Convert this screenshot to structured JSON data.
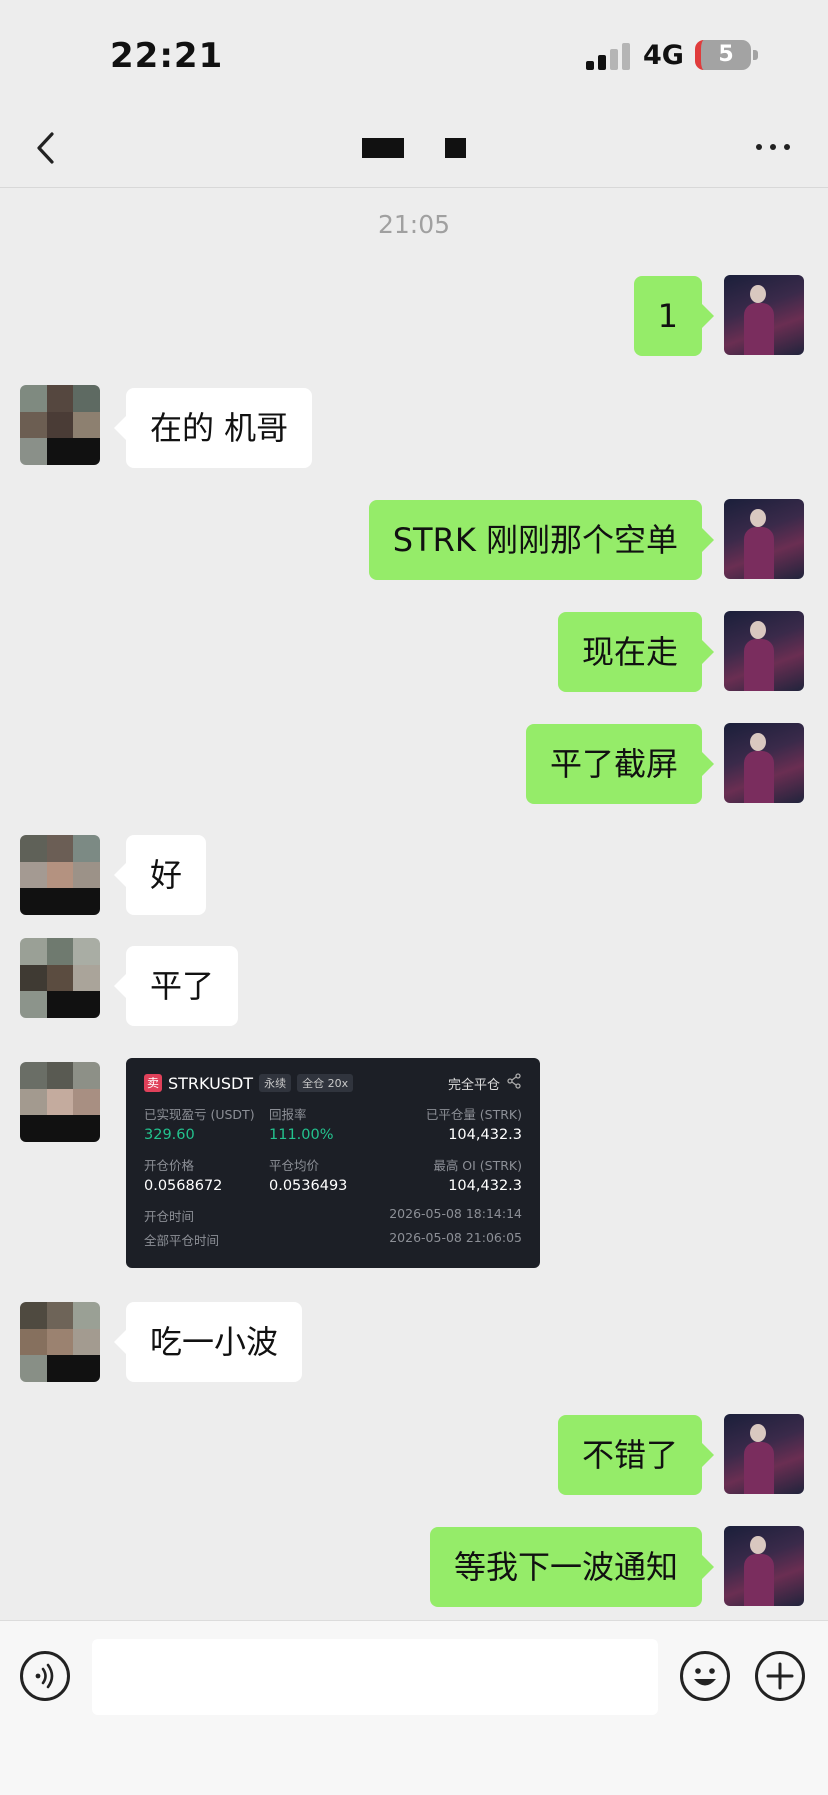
{
  "status_bar": {
    "time": "22:21",
    "network": "4G",
    "battery": "5"
  },
  "nav": {
    "back_icon": "chevron-left-icon",
    "more_icon": "more-dots-icon"
  },
  "timestamp": "21:05",
  "messages": [
    {
      "side": "out",
      "text": "1"
    },
    {
      "side": "in",
      "text": "在的 机哥"
    },
    {
      "side": "out",
      "text": "STRK 刚刚那个空单"
    },
    {
      "side": "out",
      "text": "现在走"
    },
    {
      "side": "out",
      "text": "平了截屏"
    },
    {
      "side": "in",
      "text": "好"
    },
    {
      "side": "in",
      "text": "平了"
    },
    {
      "side": "in",
      "type": "image"
    },
    {
      "side": "in",
      "text": "吃一小波"
    },
    {
      "side": "out",
      "text": "不错了"
    },
    {
      "side": "out",
      "text": "等我下一波通知"
    }
  ],
  "trade_card": {
    "side_badge": "卖",
    "symbol": "STRKUSDT",
    "tag_perp": "永续",
    "tag_margin": "全仓 20x",
    "status": "完全平仓",
    "realized_pnl_label": "已实现盈亏 (USDT)",
    "realized_pnl": "329.60",
    "roi_label": "回报率",
    "roi": "111.00%",
    "closed_qty_label": "已平仓量 (STRK)",
    "closed_qty": "104,432.3",
    "open_price_label": "开仓价格",
    "open_price": "0.0568672",
    "close_avg_label": "平仓均价",
    "close_avg": "0.0536493",
    "max_oi_label": "最高 OI (STRK)",
    "max_oi": "104,432.3",
    "open_time_label": "开仓时间",
    "open_time": "2026-05-08 18:14:14",
    "close_time_label": "全部平仓时间",
    "close_time": "2026-05-08 21:06:05"
  },
  "input_bar": {
    "voice_icon": "voice-icon",
    "emoji_icon": "emoji-icon",
    "add_icon": "plus-icon"
  },
  "colors": {
    "background": "#ededed",
    "outgoing_bubble": "#95ec69",
    "incoming_bubble": "#ffffff",
    "pnl_green": "#23c28e",
    "card_bg": "#1c1f26"
  }
}
